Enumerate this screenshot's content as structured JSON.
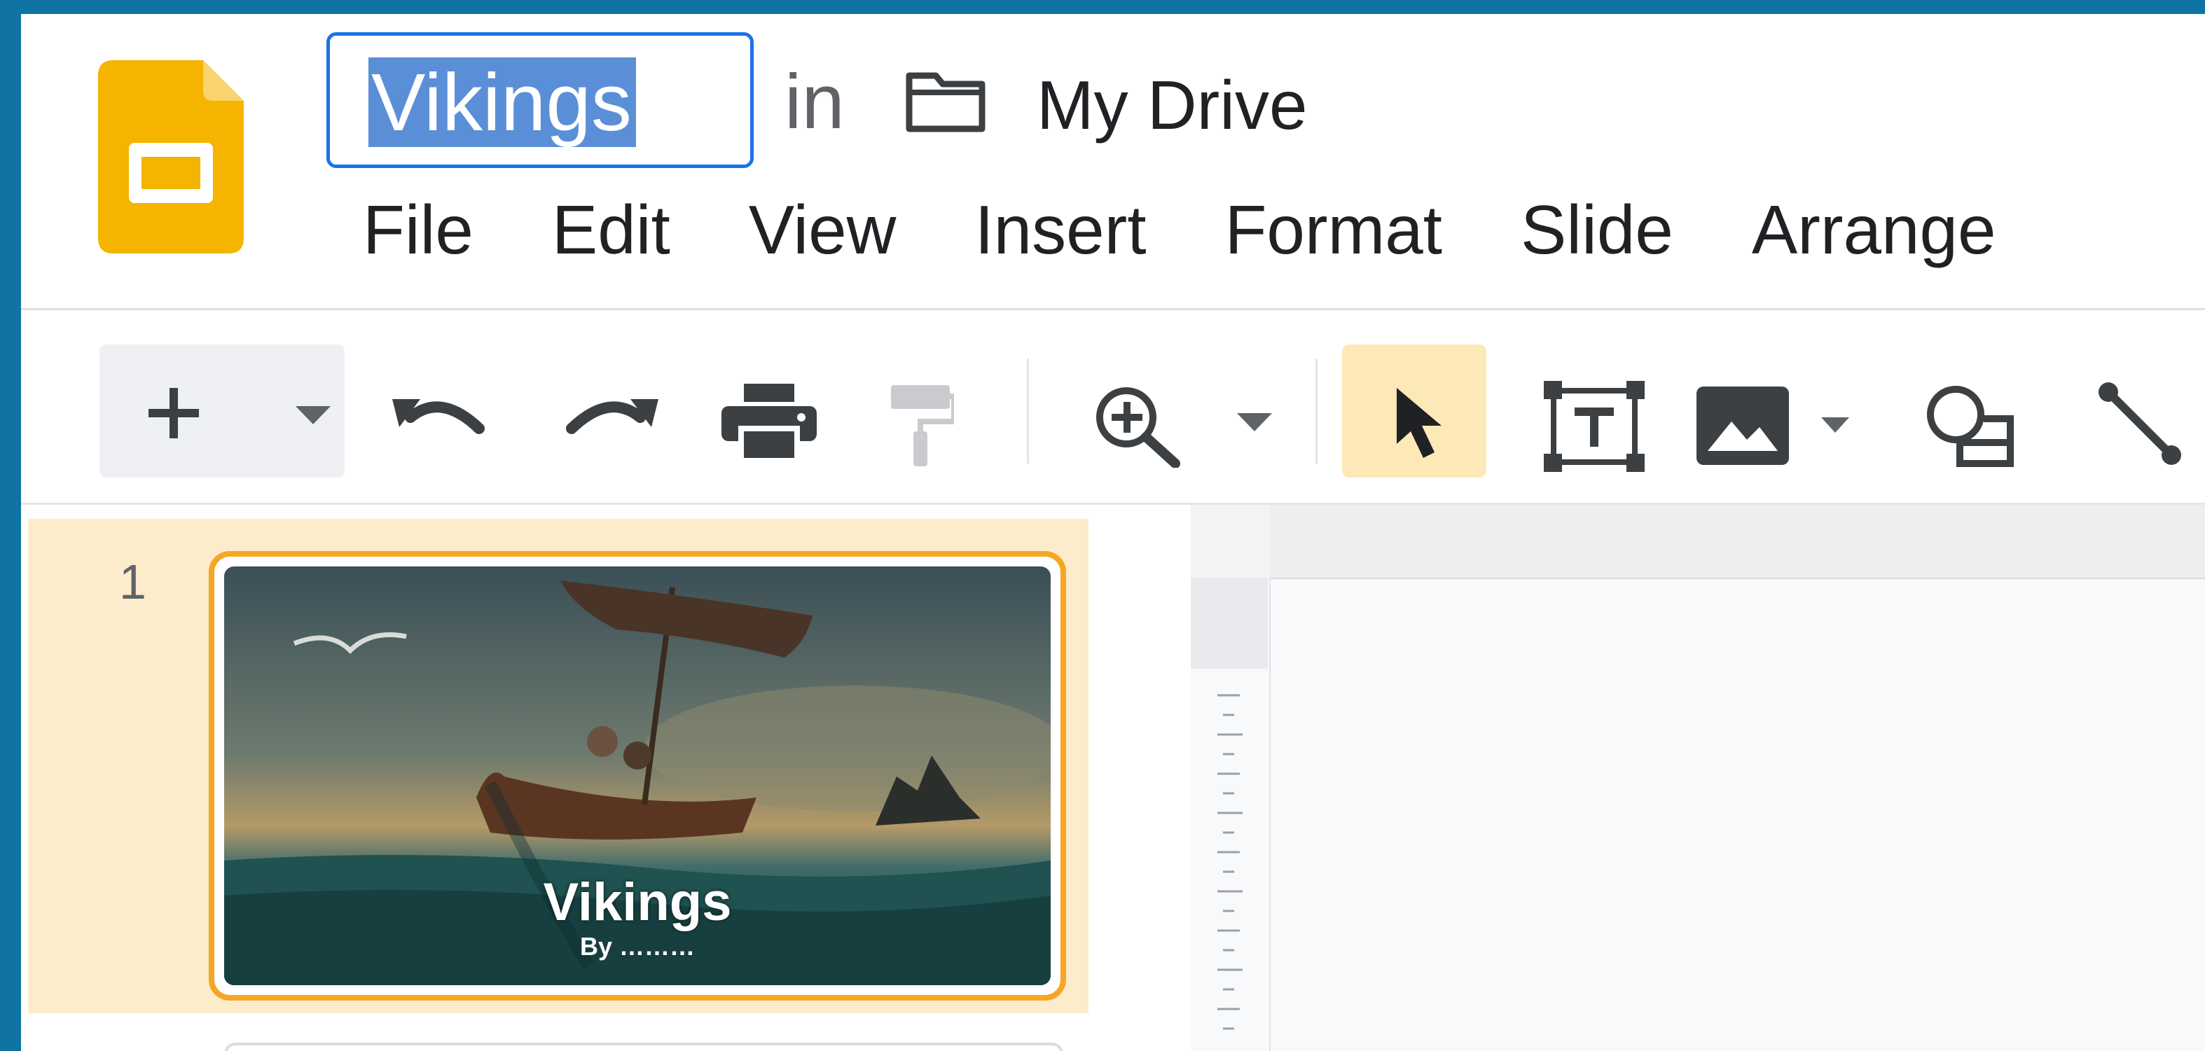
{
  "document": {
    "title": "Vikings",
    "location_prefix": "in",
    "location": "My Drive"
  },
  "menu": [
    "File",
    "Edit",
    "View",
    "Insert",
    "Format",
    "Slide",
    "Arrange"
  ],
  "toolbar": {
    "icons": [
      "plus-icon",
      "chevron-down-icon",
      "undo-icon",
      "redo-icon",
      "print-icon",
      "paint-format-icon",
      "zoom-icon",
      "chevron-down-icon",
      "select-cursor-icon",
      "text-box-icon",
      "image-icon",
      "chevron-down-icon",
      "shape-icon",
      "line-icon"
    ]
  },
  "filmstrip": {
    "slides": [
      {
        "number": "1",
        "title": "Vikings",
        "subtitle": "By ………"
      }
    ]
  },
  "colors": {
    "frame": "#0f74a4",
    "title_focus": "#1a73e8",
    "selection": "#f5a623",
    "selection_bg": "#fdeccb",
    "slides_logo": "#f4b400"
  }
}
